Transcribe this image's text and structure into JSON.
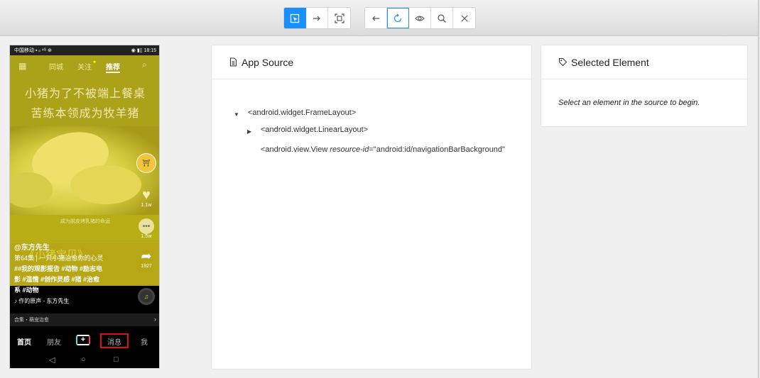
{
  "toolbar": {
    "group1": [
      {
        "name": "select-element-icon",
        "glyph": "⬚",
        "active": true
      },
      {
        "name": "swipe-arrow-icon",
        "glyph": "→",
        "active": false
      },
      {
        "name": "screenshot-crop-icon",
        "glyph": "⛶",
        "active": false
      }
    ],
    "group2": [
      {
        "name": "back-arrow-icon",
        "glyph": "←",
        "active": false
      },
      {
        "name": "refresh-icon",
        "glyph": "↻",
        "active": false
      },
      {
        "name": "eye-icon",
        "glyph": "◉",
        "active": false
      },
      {
        "name": "search-icon",
        "glyph": "⌕",
        "active": false
      },
      {
        "name": "close-icon",
        "glyph": "✕",
        "active": false
      }
    ]
  },
  "phone": {
    "status_left": "中国移动 ▪ ᵢₗ ⁴ᴳ ⊛",
    "status_right": "◉ ▮▯ 18:15",
    "topnav": {
      "nearby": "同城",
      "following": "关注",
      "recommend": "推荐"
    },
    "title_line1": "小猪为了不被端上餐桌",
    "title_line2": "苦练本领成为牧羊猪",
    "caption": "成为脱皮烤乳猪的命运",
    "movie_title": "《小猪宝贝》",
    "side": {
      "likes": "1.1w",
      "comments": "1.5w",
      "shares": "1927"
    },
    "author": "@东方先生",
    "episode": "第64集 | 一只小猪治愈你的心灵",
    "tags_line1": "##我的观影报告 #动物 #励志电",
    "tags_line2": "影 #温情 #创作灵感 #猪 #治愈",
    "tags_line3": "系 #动物",
    "music": "♪ 作的原声 - 东方先生",
    "collection": "合集・萌宠治愈",
    "tabs": {
      "home": "首页",
      "friends": "朋友",
      "plus": "+",
      "messages": "消息",
      "me": "我"
    },
    "nav": {
      "back": "◁",
      "home": "○",
      "recent": "□"
    }
  },
  "source_panel": {
    "title": "App Source",
    "nodes": [
      {
        "caret": "▼",
        "text": "<android.widget.FrameLayout>"
      },
      {
        "caret": "▶",
        "text": "<android.widget.LinearLayout>"
      },
      {
        "caret": "",
        "tag": "<android.view.View ",
        "attr": "resource-id",
        "value": "=\"android:id/navigationBarBackground\""
      }
    ]
  },
  "selected_panel": {
    "title": "Selected Element",
    "hint": "Select an element in the source to begin."
  },
  "colors": {
    "accent": "#1890ff",
    "video_yellow": "#b7a717",
    "highlight_red": "#e01010"
  }
}
